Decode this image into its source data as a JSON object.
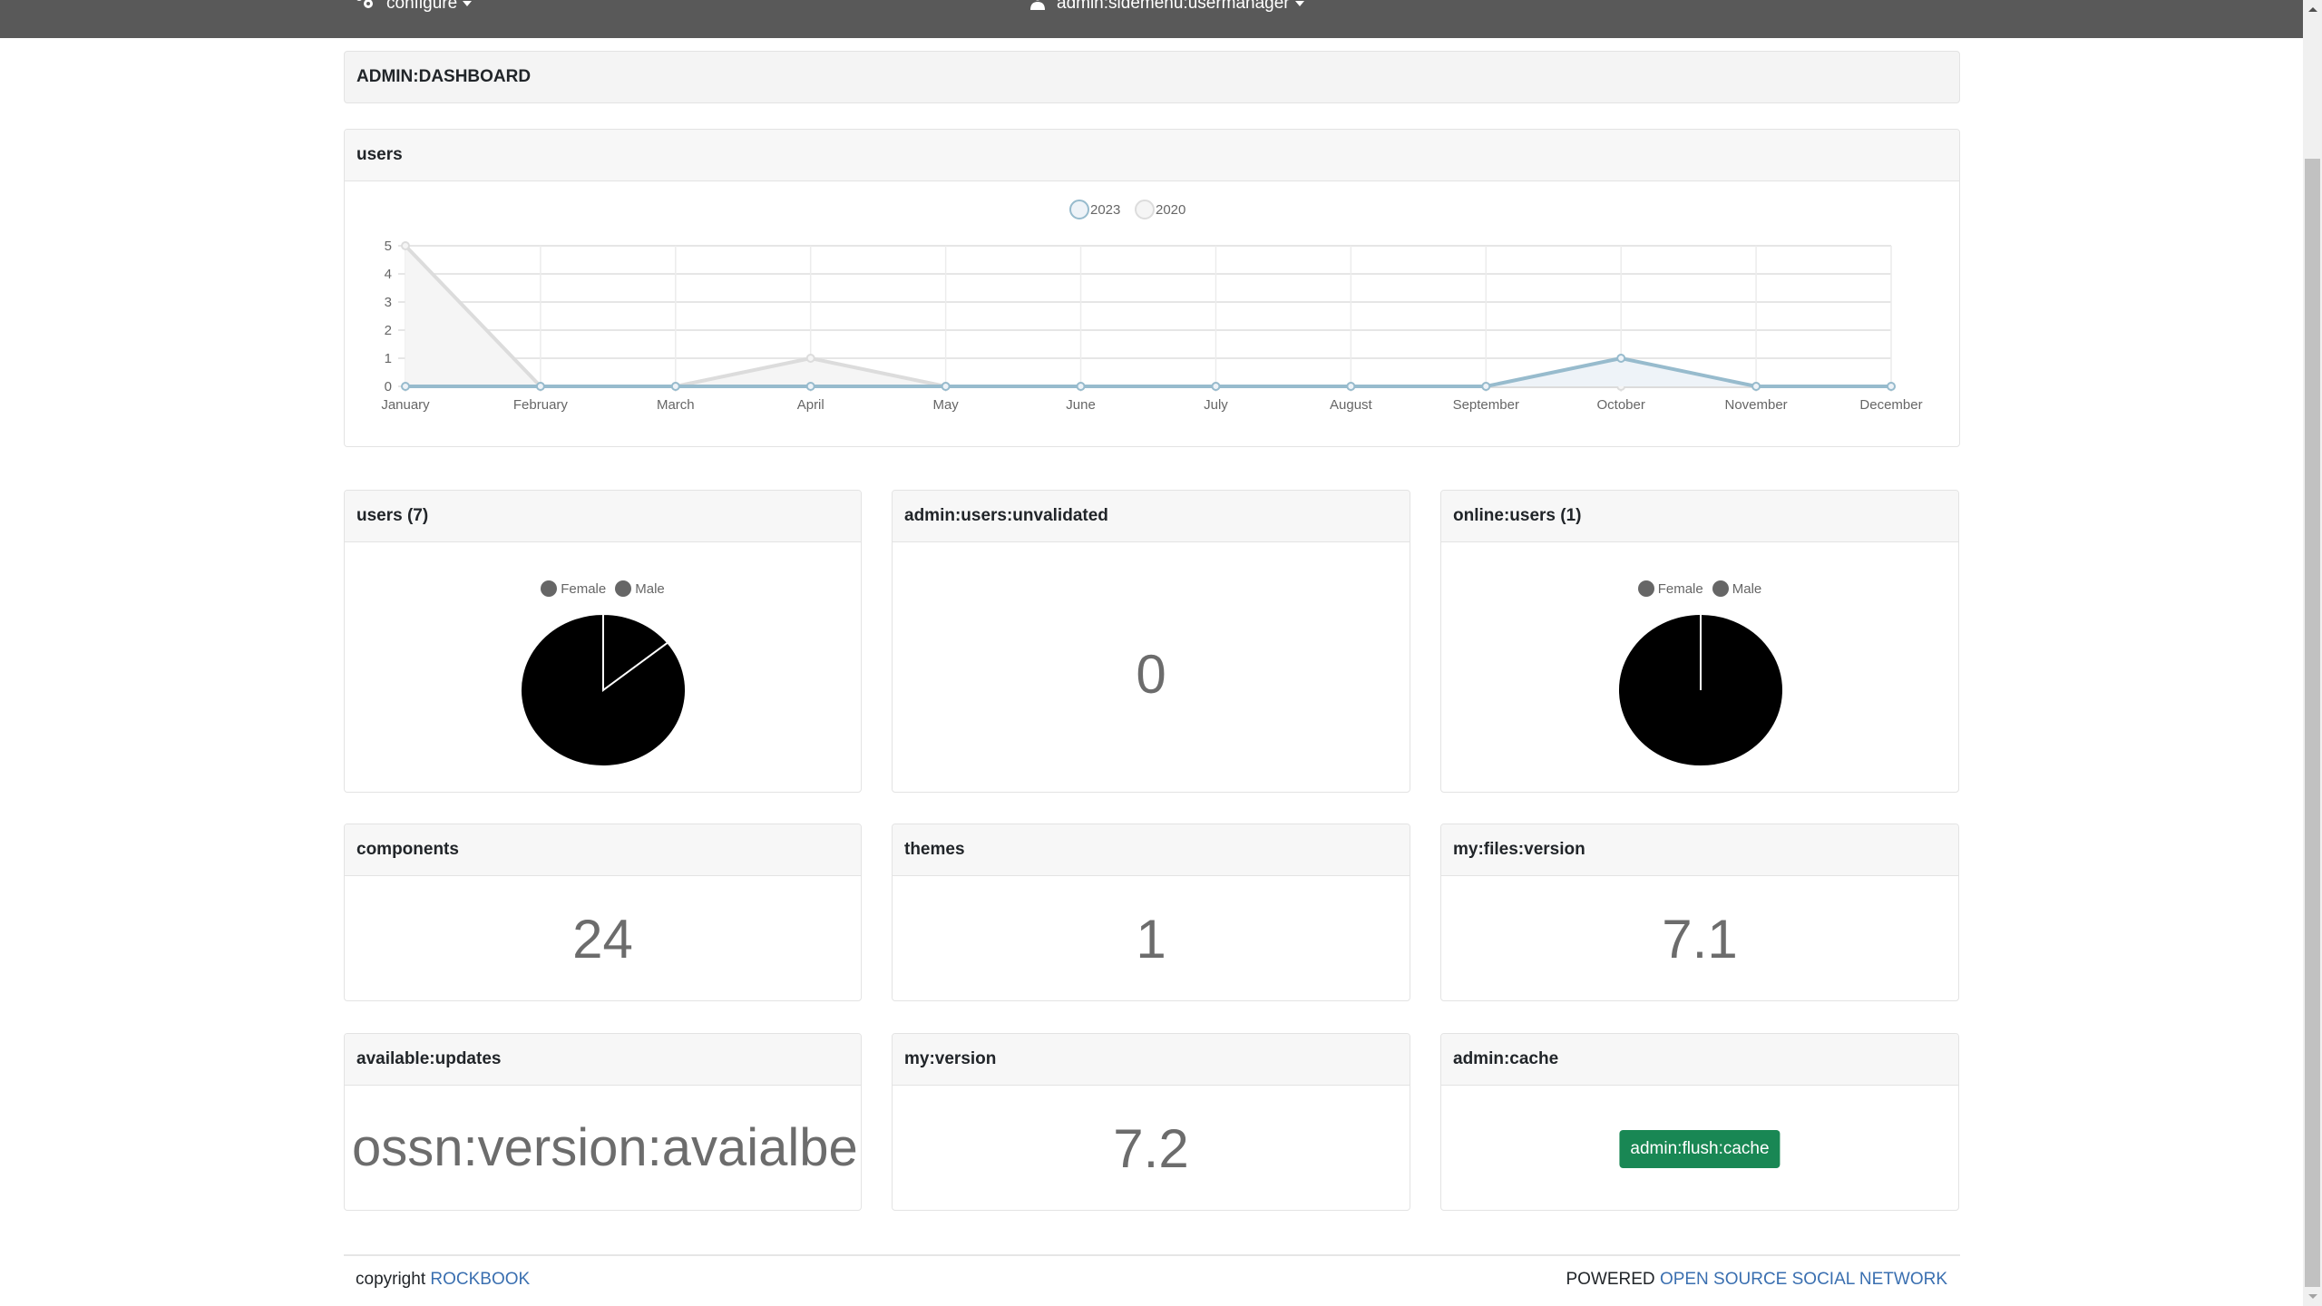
{
  "navbar": {
    "configure_label": "configure",
    "configure_icon": "cogs-icon",
    "usermanager_label": "admin:sidemenu:usermanager",
    "usermanager_icon": "user-icon"
  },
  "dashboard": {
    "title": "ADMIN:DASHBOARD"
  },
  "users_chart_card": {
    "title": "users"
  },
  "chart_data": [
    {
      "type": "line",
      "title": "users",
      "categories": [
        "January",
        "February",
        "March",
        "April",
        "May",
        "June",
        "July",
        "August",
        "September",
        "October",
        "November",
        "December"
      ],
      "series": [
        {
          "name": "2023",
          "values": [
            0,
            0,
            0,
            0,
            0,
            0,
            0,
            0,
            0,
            1,
            0,
            0
          ],
          "color": "#97bbcd",
          "fill": "#eef3f8"
        },
        {
          "name": "2020",
          "values": [
            5,
            0,
            0,
            1,
            0,
            0,
            0,
            0,
            0,
            0,
            0,
            0
          ],
          "color": "#dcdcdc",
          "fill": "#f5f5f5"
        }
      ],
      "yticks": [
        "0",
        "1",
        "2",
        "3",
        "4",
        "5"
      ],
      "ylim": [
        0,
        5
      ],
      "grid": true,
      "legend": "top-center",
      "xlabel": "",
      "ylabel": ""
    },
    {
      "type": "pie",
      "title": "users (7)",
      "labels": [
        "Female",
        "Male"
      ],
      "values": [
        1,
        6
      ],
      "legend": "top-center"
    },
    {
      "type": "pie",
      "title": "online:users (1)",
      "labels": [
        "Female",
        "Male"
      ],
      "values": [
        0,
        1
      ],
      "legend": "top-center"
    }
  ],
  "cards": {
    "users": {
      "title": "users (7)"
    },
    "unvalidated": {
      "title": "admin:users:unvalidated",
      "value": "0"
    },
    "online": {
      "title": "online:users (1)"
    },
    "components": {
      "title": "components",
      "value": "24"
    },
    "themes": {
      "title": "themes",
      "value": "1"
    },
    "files_version": {
      "title": "my:files:version",
      "value": "7.1"
    },
    "updates": {
      "title": "available:updates",
      "value": "ossn:version:avaialbe"
    },
    "my_version": {
      "title": "my:version",
      "value": "7.2"
    },
    "cache": {
      "title": "admin:cache",
      "button_label": "admin:flush:cache"
    }
  },
  "footer": {
    "copyright_label": "copyright",
    "site_link": "ROCKBOOK",
    "powered_label": "POWERED",
    "powered_link": "OPEN SOURCE SOCIAL NETWORK"
  },
  "colors": {
    "navbar": "#595959",
    "flush_button": "#198754",
    "link": "#3a6fb0"
  }
}
